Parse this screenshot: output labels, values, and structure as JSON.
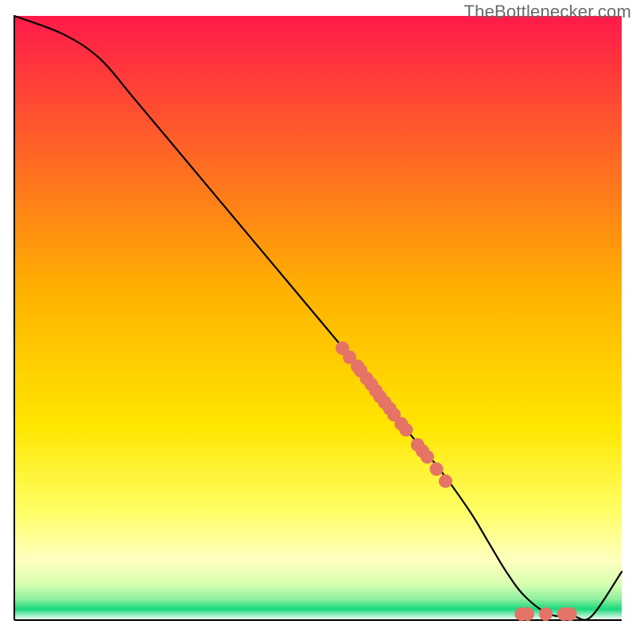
{
  "watermark": "TheBottlenecker.com",
  "colors": {
    "top": "#ff1a4a",
    "mid": "#ffd900",
    "paleYellow": "#ffff9e",
    "bottomGreen": "#1ad97a",
    "white": "#ffffff",
    "curve": "#000000",
    "dot_fill": "#e57366",
    "dot_stroke": "#c95a4f"
  },
  "chart_data": {
    "type": "line",
    "title": "",
    "xlabel": "",
    "ylabel": "",
    "xlim": [
      0,
      100
    ],
    "ylim": [
      0,
      100
    ],
    "series": [
      {
        "name": "bottleneck-curve",
        "x": [
          0,
          8,
          14,
          20,
          30,
          40,
          50,
          55,
          60,
          65,
          70,
          75,
          78,
          81,
          84,
          88,
          92,
          95,
          100
        ],
        "y": [
          100,
          97,
          93,
          86,
          74,
          62,
          50,
          44,
          38,
          31,
          25,
          18,
          13,
          8,
          4,
          1,
          0.6,
          0.6,
          8
        ]
      }
    ],
    "scatter_points": [
      {
        "x": 54.0,
        "y": 45.0
      },
      {
        "x": 55.2,
        "y": 43.5
      },
      {
        "x": 56.5,
        "y": 42.0
      },
      {
        "x": 57.0,
        "y": 41.3
      },
      {
        "x": 58.0,
        "y": 40.0
      },
      {
        "x": 58.8,
        "y": 39.0
      },
      {
        "x": 59.5,
        "y": 38.0
      },
      {
        "x": 60.2,
        "y": 37.0
      },
      {
        "x": 61.0,
        "y": 36.0
      },
      {
        "x": 61.8,
        "y": 35.0
      },
      {
        "x": 62.5,
        "y": 34.0
      },
      {
        "x": 63.7,
        "y": 32.5
      },
      {
        "x": 64.5,
        "y": 31.5
      },
      {
        "x": 66.4,
        "y": 29.0
      },
      {
        "x": 67.2,
        "y": 28.0
      },
      {
        "x": 68.0,
        "y": 27.0
      },
      {
        "x": 69.5,
        "y": 25.0
      },
      {
        "x": 71.0,
        "y": 23.0
      },
      {
        "x": 83.5,
        "y": 1.0
      },
      {
        "x": 84.5,
        "y": 1.0
      },
      {
        "x": 87.5,
        "y": 1.0
      },
      {
        "x": 90.5,
        "y": 1.0
      },
      {
        "x": 91.5,
        "y": 1.0
      }
    ]
  }
}
